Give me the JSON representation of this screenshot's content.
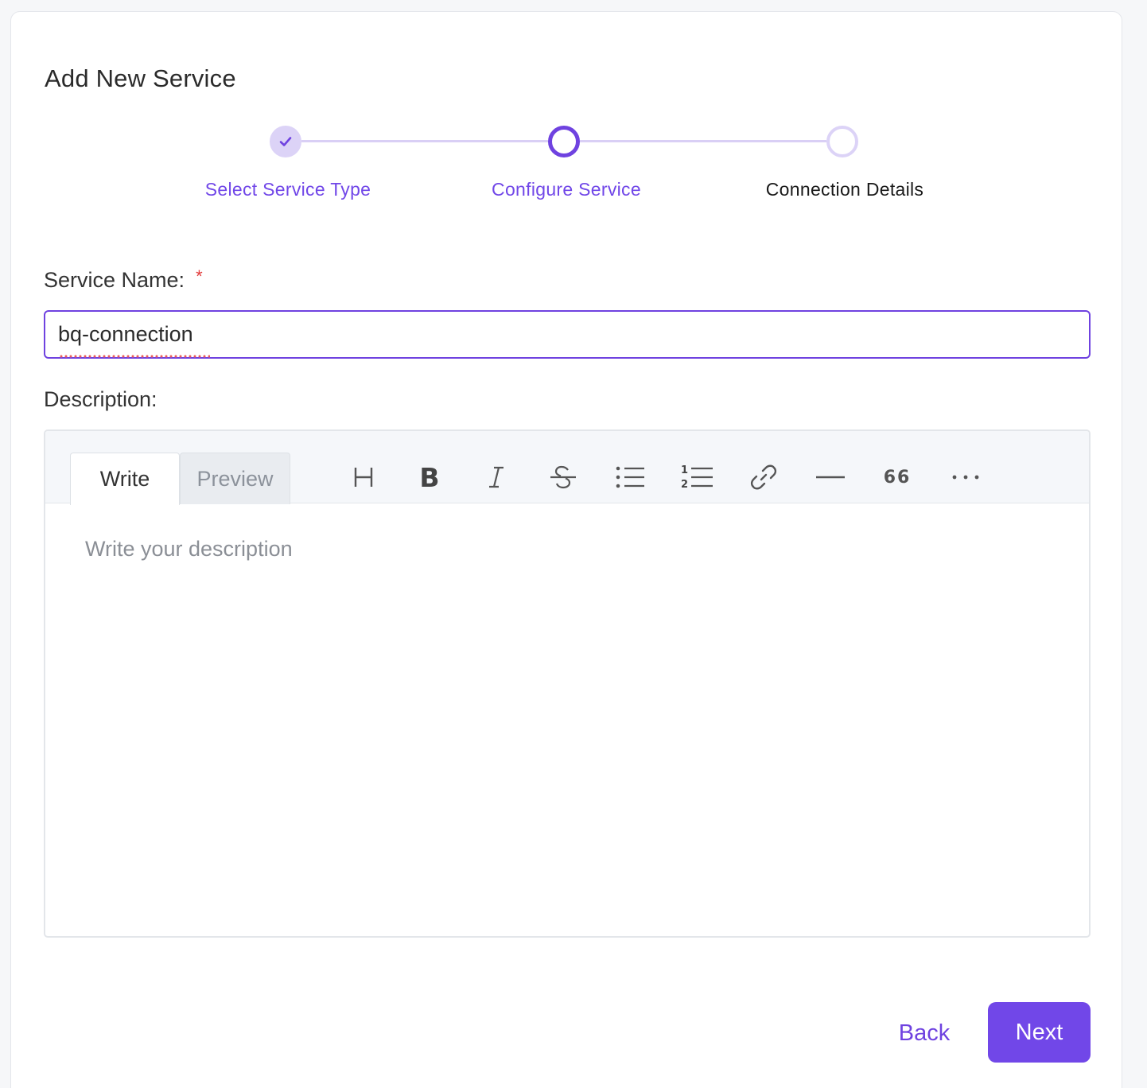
{
  "modal": {
    "title": "Add New Service"
  },
  "stepper": {
    "steps": [
      {
        "label": "Select Service Type",
        "state": "completed"
      },
      {
        "label": "Configure Service",
        "state": "active"
      },
      {
        "label": "Connection Details",
        "state": "pending"
      }
    ]
  },
  "form": {
    "service_name": {
      "label": "Service Name:",
      "required_marker": "*",
      "value": "bq-connection"
    },
    "description": {
      "label": "Description:",
      "tabs": [
        "Write",
        "Preview"
      ],
      "active_tab": "Write",
      "toolbar_icons": [
        "heading-icon",
        "bold-icon",
        "italic-icon",
        "strikethrough-icon",
        "bullet-list-icon",
        "numbered-list-icon",
        "link-icon",
        "horizontal-rule-icon",
        "quote-icon",
        "more-icon"
      ],
      "placeholder": "Write your description"
    }
  },
  "footer": {
    "back_label": "Back",
    "next_label": "Next"
  },
  "colors": {
    "accent": "#7147e8",
    "required": "#e23b3b"
  }
}
